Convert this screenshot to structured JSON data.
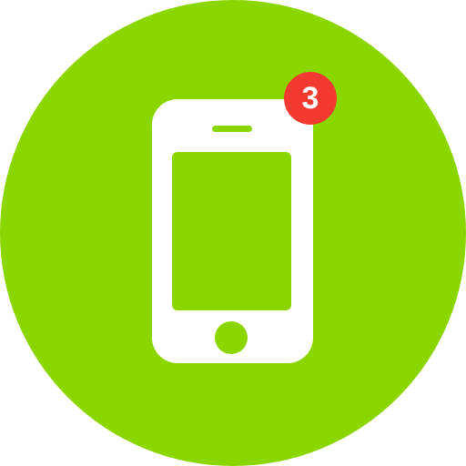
{
  "icon": {
    "name": "phone-notification-icon",
    "background_color": "#8cd600",
    "device_color": "#ffffff",
    "screen_color": "#8cd600"
  },
  "badge": {
    "count": "3",
    "color": "#f23a30",
    "text_color": "#ffffff"
  }
}
